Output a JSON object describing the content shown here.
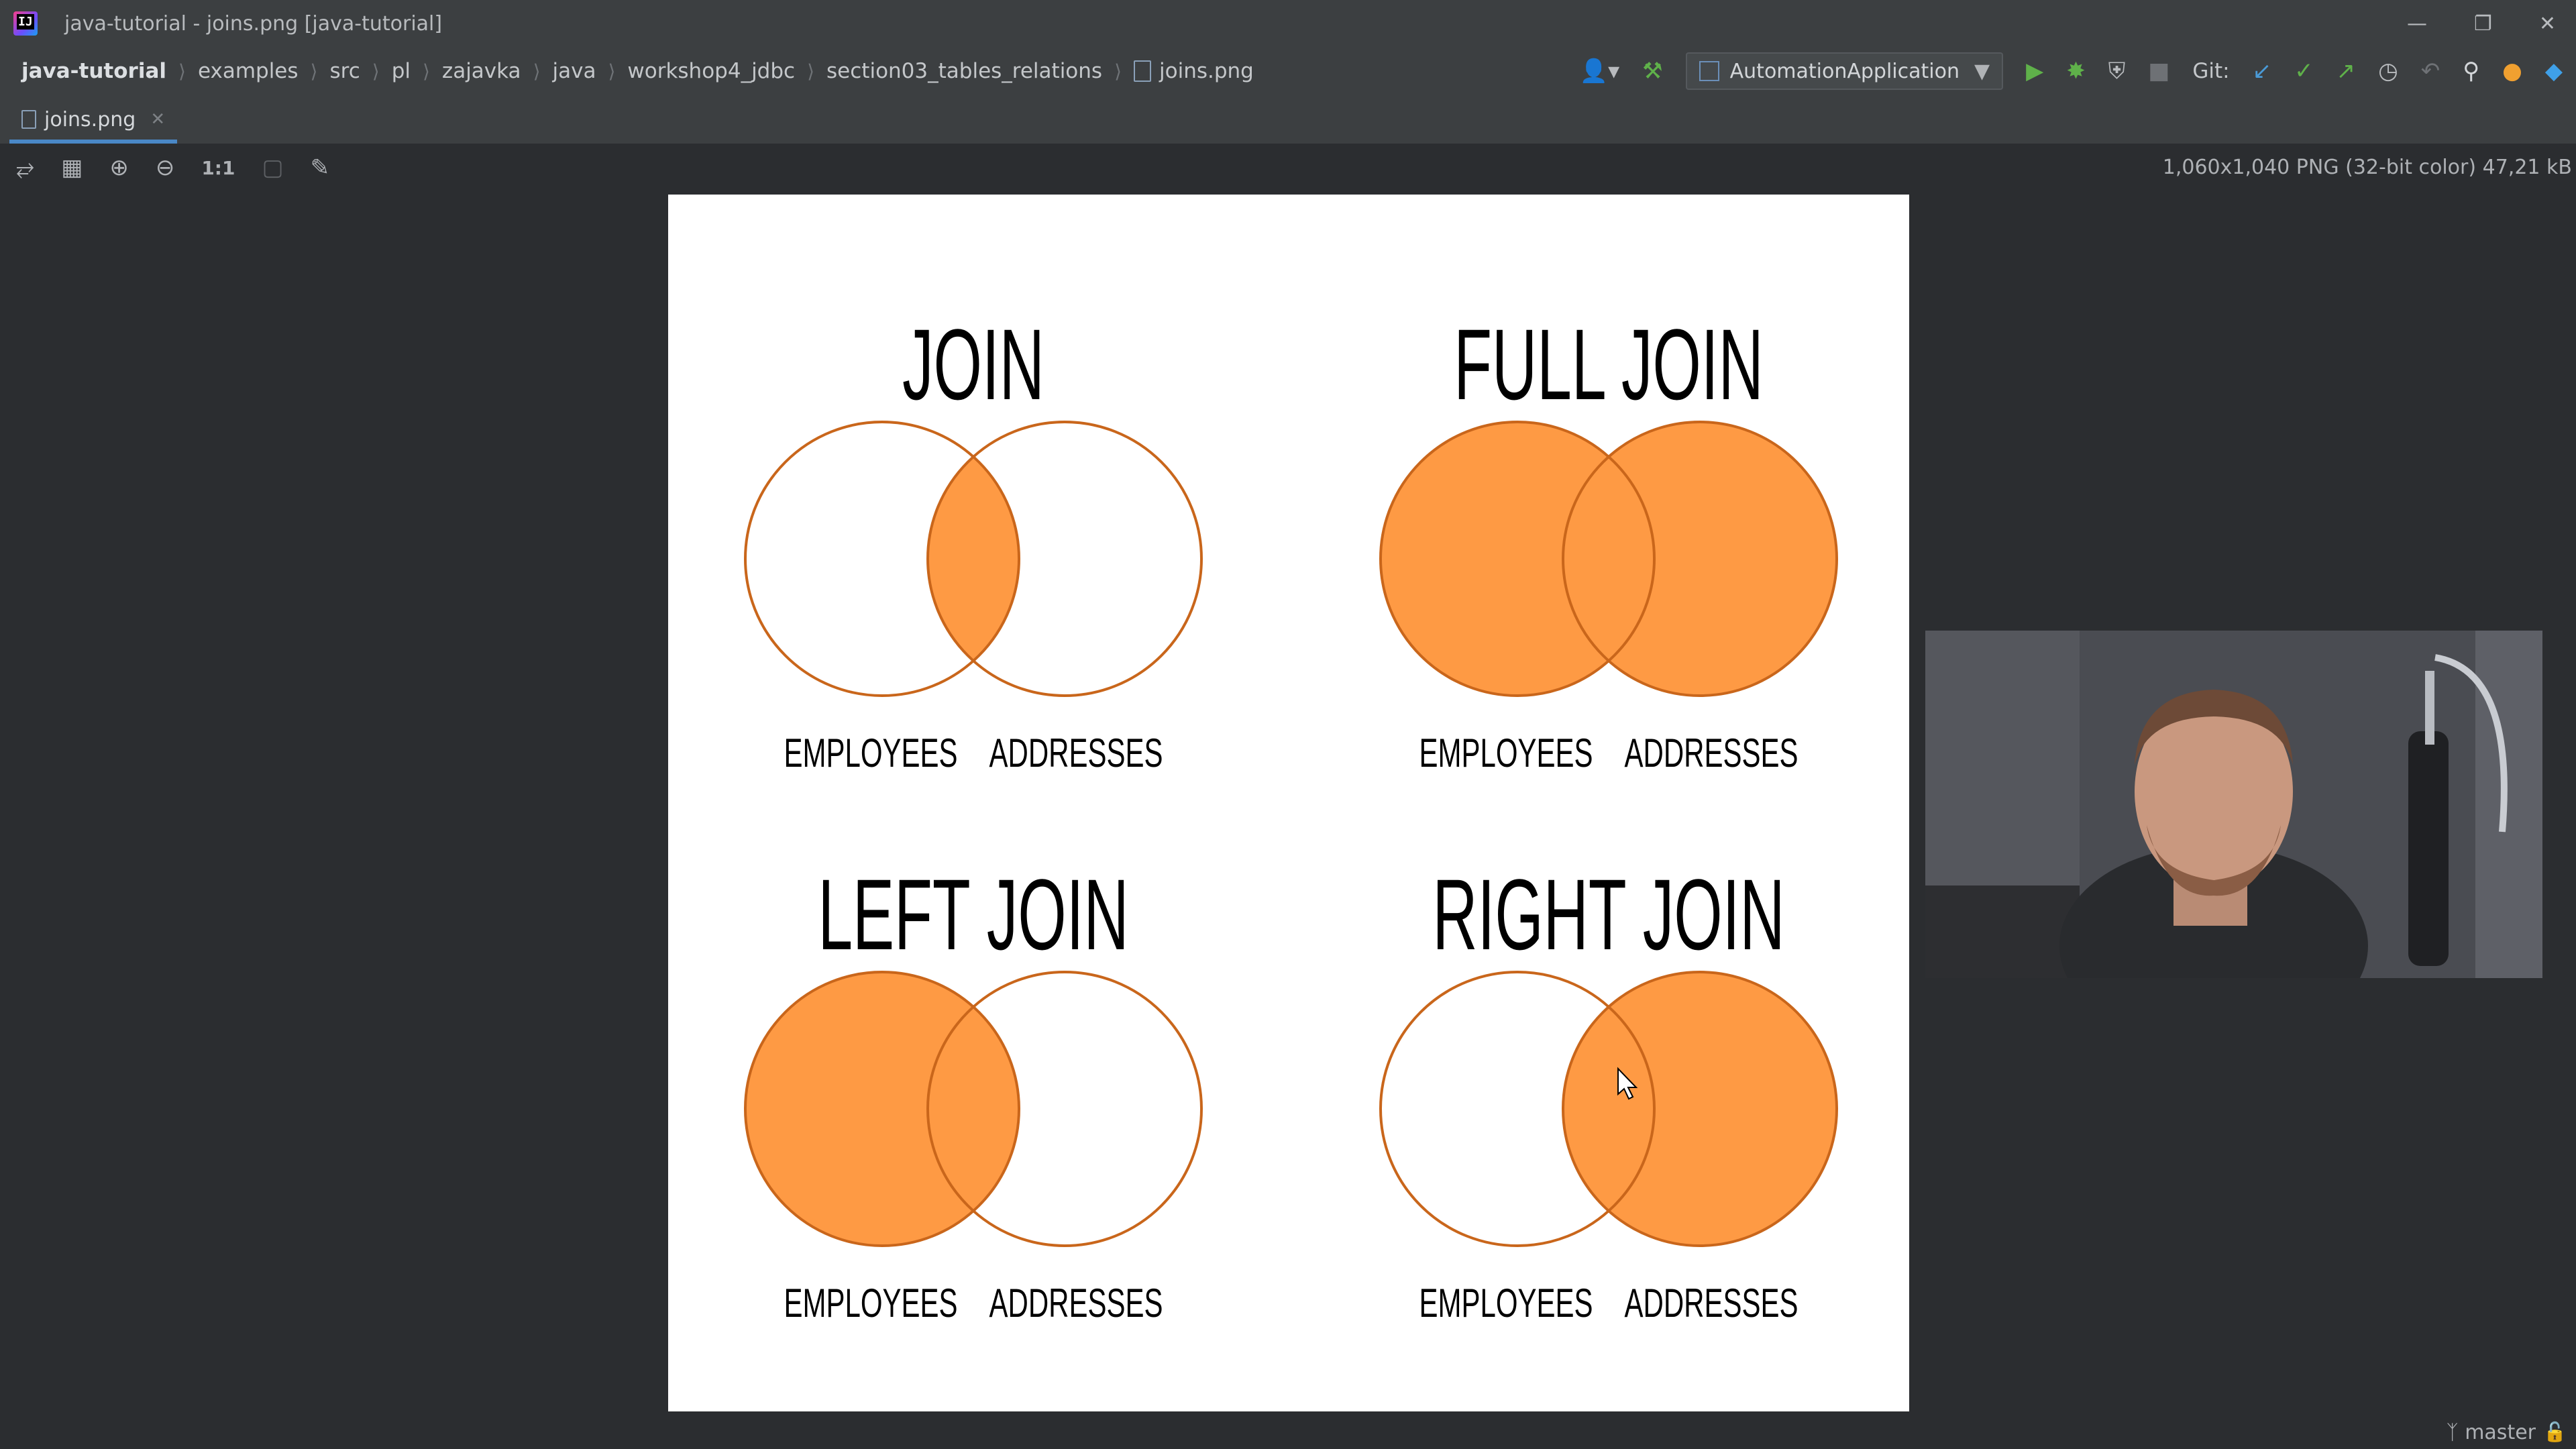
{
  "window": {
    "title": "java-tutorial - joins.png [java-tutorial]"
  },
  "breadcrumb": [
    "java-tutorial",
    "examples",
    "src",
    "pl",
    "zajavka",
    "java",
    "workshop4_jdbc",
    "section03_tables_relations"
  ],
  "breadcrumb_file": "joins.png",
  "run_config": {
    "label": "AutomationApplication"
  },
  "git": {
    "label": "Git:"
  },
  "tab": {
    "label": "joins.png"
  },
  "viewer": {
    "info": "1,060x1,040 PNG (32-bit color) 47,21 kB",
    "actual_size_label": "1:1"
  },
  "status": {
    "branch": "master"
  },
  "diagram": {
    "panels": [
      {
        "title": "JOIN",
        "left_label": "EMPLOYEES",
        "right_label": "ADDRESSES",
        "fill": "inner"
      },
      {
        "title": "FULL JOIN",
        "left_label": "EMPLOYEES",
        "right_label": "ADDRESSES",
        "fill": "both"
      },
      {
        "title": "LEFT JOIN",
        "left_label": "EMPLOYEES",
        "right_label": "ADDRESSES",
        "fill": "left"
      },
      {
        "title": "RIGHT JOIN",
        "left_label": "EMPLOYEES",
        "right_label": "ADDRESSES",
        "fill": "right"
      }
    ],
    "colors": {
      "fill": "#fe9a44",
      "stroke": "#c9661b"
    }
  }
}
